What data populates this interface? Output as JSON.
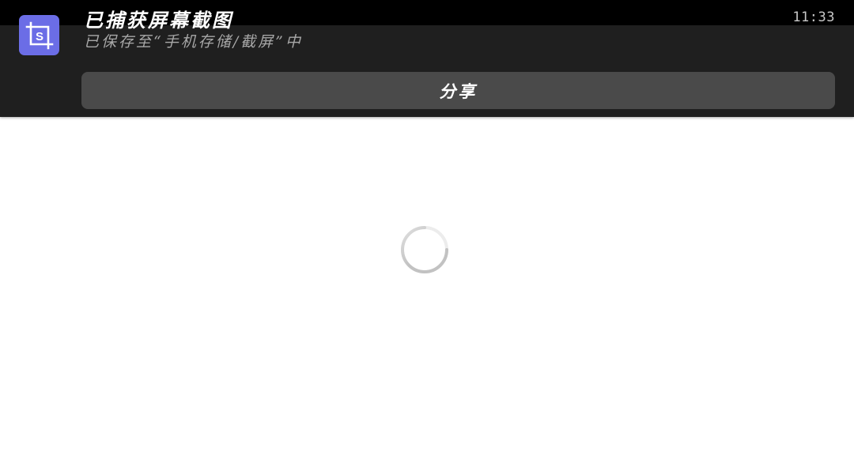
{
  "status_bar": {
    "time": "11:33"
  },
  "notification": {
    "icon": "screenshot-crop-icon",
    "icon_color": "#6b6de6",
    "title": "已捕获屏幕截图",
    "subtitle": "已保存至“手机存储/截屏”中",
    "share_label": "分享"
  },
  "content": {
    "loading_icon": "loading-spinner-icon"
  },
  "colors": {
    "notification_bg": "#1f1f1f",
    "status_bar_bg": "#000000",
    "button_bg": "#4a4a4a",
    "page_bg": "#ffffff"
  }
}
